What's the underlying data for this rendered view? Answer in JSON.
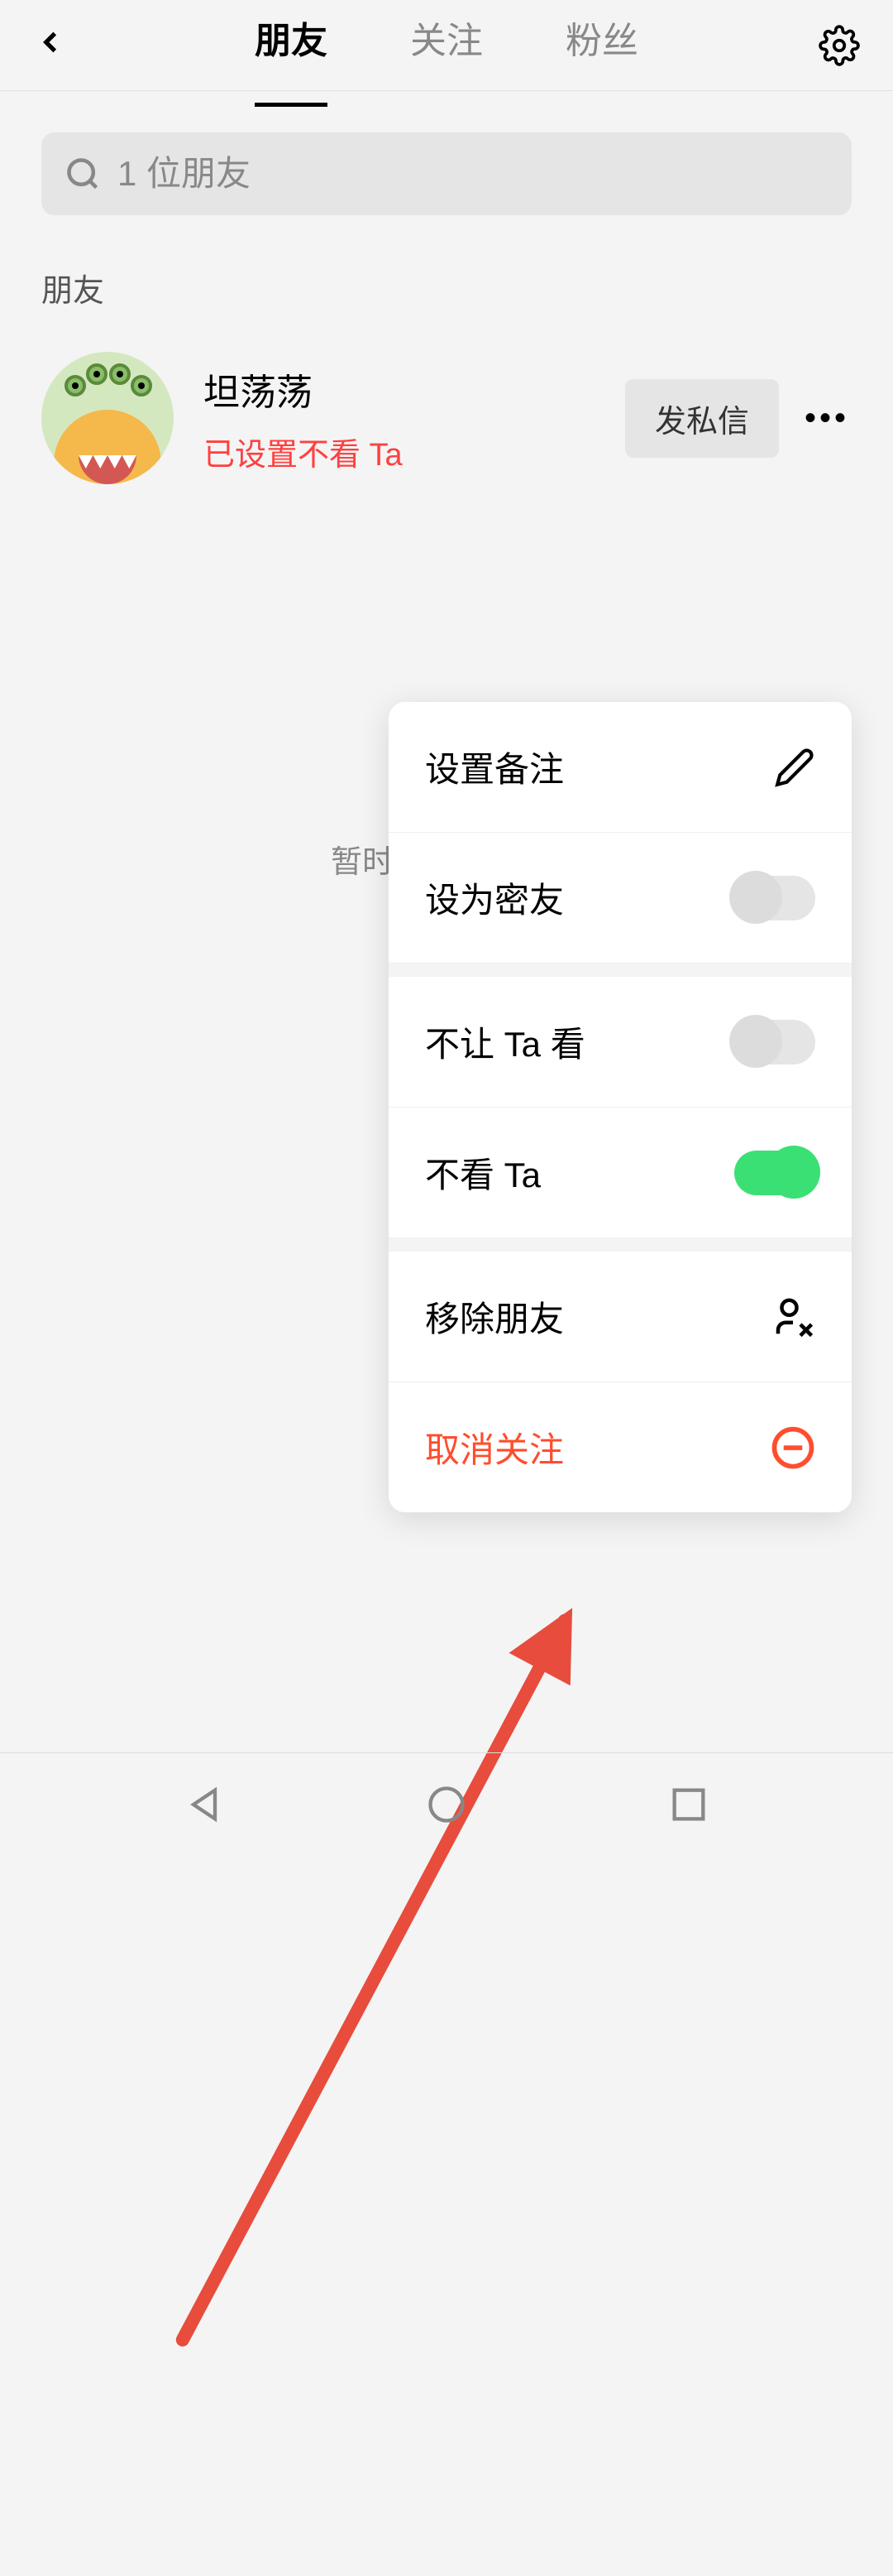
{
  "header": {
    "tabs": [
      "朋友",
      "关注",
      "粉丝"
    ],
    "active_tab": 0
  },
  "search": {
    "placeholder": "1 位朋友"
  },
  "section_label": "朋友",
  "friend": {
    "name": "坦荡荡",
    "status": "已设置不看 Ta",
    "action_button": "发私信"
  },
  "partial_text": "暂时",
  "popup": {
    "set_note": "设置备注",
    "set_close_friend": "设为密友",
    "block_from_viewing": "不让 Ta 看",
    "dont_view": "不看 Ta",
    "remove_friend": "移除朋友",
    "unfollow": "取消关注",
    "toggles": {
      "set_close_friend": false,
      "block_from_viewing": false,
      "dont_view": true
    }
  }
}
